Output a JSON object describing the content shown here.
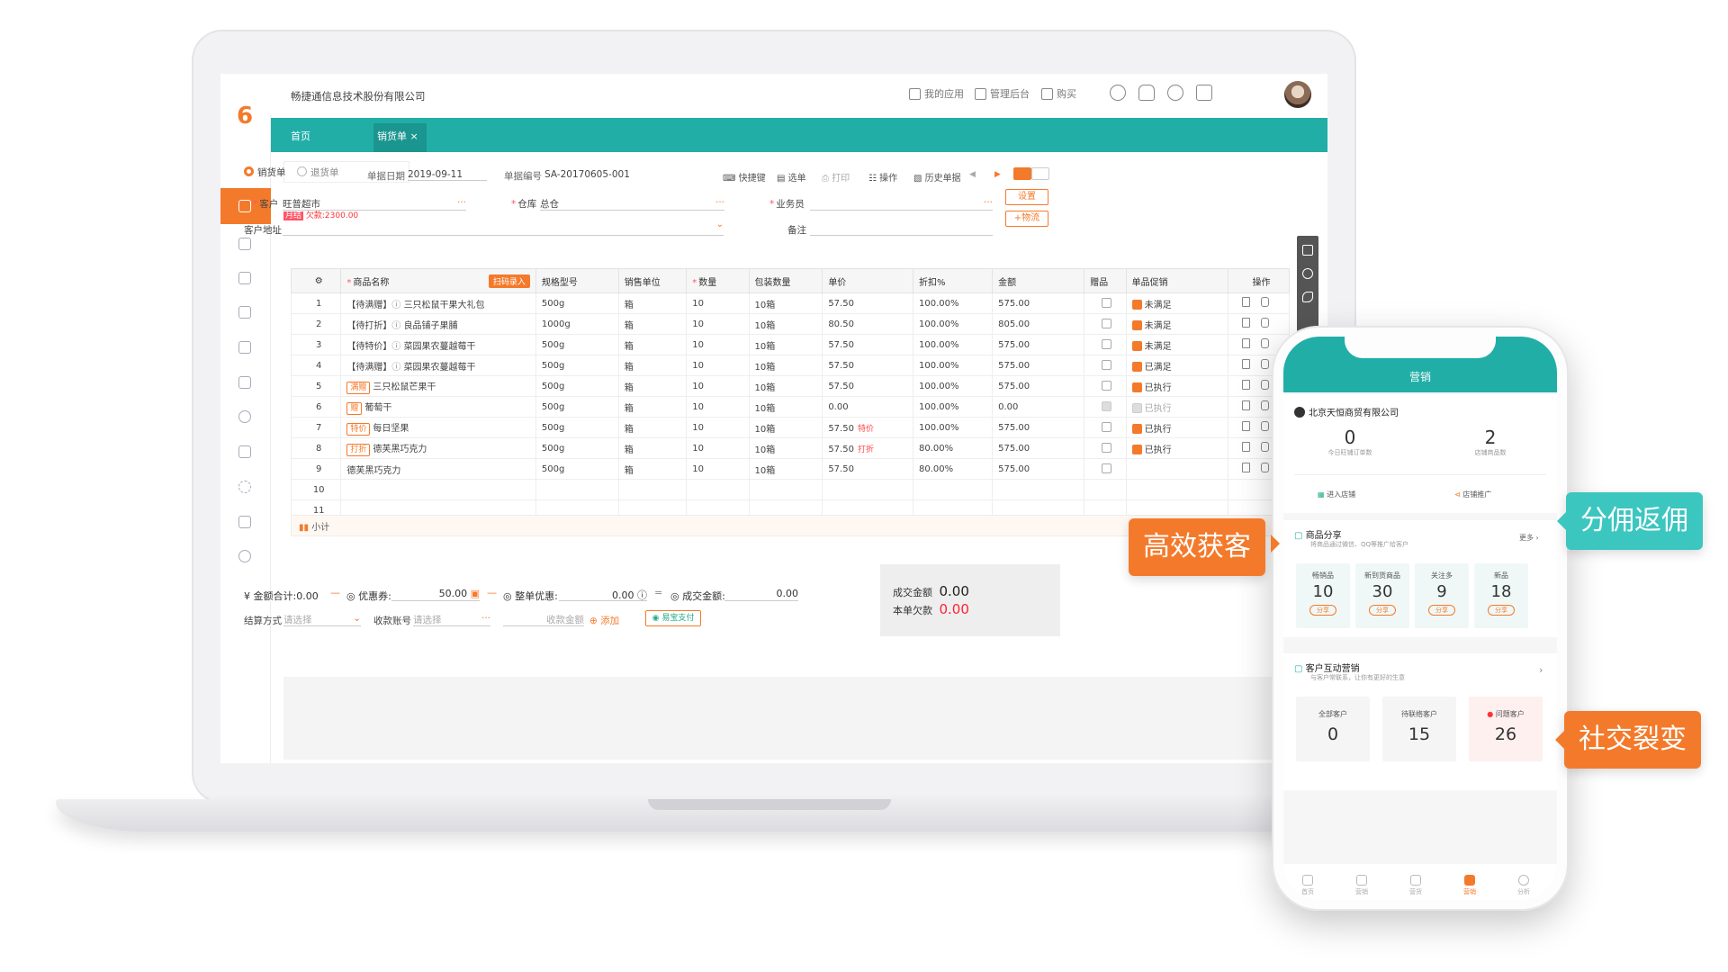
{
  "app": {
    "company": "畅捷通信息技术股份有限公司",
    "top_nav": [
      "我的应用",
      "管理后台",
      "购买"
    ],
    "tabs": [
      "首页",
      "销货单"
    ]
  },
  "form": {
    "types": [
      "销货单",
      "退货单"
    ],
    "date_label": "单据日期",
    "date_value": "2019-09-11",
    "no_label": "单据编号",
    "no_value": "SA-20170605-001",
    "tools": [
      "快捷键",
      "选单",
      "打印",
      "操作",
      "历史单据"
    ],
    "customer_label": "客户",
    "customer_value": "旺普超市",
    "monthly_tag": "月结",
    "debt_text": "欠款:2300.00",
    "warehouse_label": "仓库",
    "warehouse_value": "总仓",
    "salesman_label": "业务员",
    "address_label": "客户地址",
    "remark_label": "备注",
    "settings_btn": "设置",
    "logistics_btn": "+物流"
  },
  "table": {
    "headers": [
      "商品名称",
      "扫码录入",
      "规格型号",
      "销售单位",
      "数量",
      "包装数量",
      "单价",
      "折扣%",
      "金额",
      "赠品",
      "单品促销",
      "操作"
    ],
    "rows": [
      {
        "n": "1",
        "tag": "",
        "name": "【待满赠】",
        "name2": "三只松鼠干果大礼包",
        "spec": "500g",
        "unit": "箱",
        "qty": "10",
        "pack": "10箱",
        "price": "57.50",
        "price_tag": "",
        "disc": "100.00%",
        "amt": "575.00",
        "promo": "未满足",
        "gift": "0",
        "promo_on": "1"
      },
      {
        "n": "2",
        "tag": "",
        "name": "【待打折】",
        "name2": "良品铺子果脯",
        "spec": "1000g",
        "unit": "箱",
        "qty": "10",
        "pack": "10箱",
        "price": "80.50",
        "price_tag": "",
        "disc": "100.00%",
        "amt": "805.00",
        "promo": "未满足",
        "gift": "0",
        "promo_on": "1"
      },
      {
        "n": "3",
        "tag": "",
        "name": "【待特价】",
        "name2": "菜园果农蔓越莓干",
        "spec": "500g",
        "unit": "箱",
        "qty": "10",
        "pack": "10箱",
        "price": "57.50",
        "price_tag": "",
        "disc": "100.00%",
        "amt": "575.00",
        "promo": "未满足",
        "gift": "0",
        "promo_on": "1"
      },
      {
        "n": "4",
        "tag": "",
        "name": "【待满赠】",
        "name2": "菜园果农蔓越莓干",
        "spec": "500g",
        "unit": "箱",
        "qty": "10",
        "pack": "10箱",
        "price": "57.50",
        "price_tag": "",
        "disc": "100.00%",
        "amt": "575.00",
        "promo": "已满足",
        "gift": "0",
        "promo_on": "1"
      },
      {
        "n": "5",
        "tag": "满赠",
        "name": "",
        "name2": "三只松鼠芒果干",
        "spec": "500g",
        "unit": "箱",
        "qty": "10",
        "pack": "10箱",
        "price": "57.50",
        "price_tag": "",
        "disc": "100.00%",
        "amt": "575.00",
        "promo": "已执行",
        "gift": "0",
        "promo_on": "1"
      },
      {
        "n": "6",
        "tag": "赠",
        "name": "",
        "name2": "葡萄干",
        "spec": "500g",
        "unit": "箱",
        "qty": "10",
        "pack": "10箱",
        "price": "0.00",
        "price_tag": "",
        "disc": "100.00%",
        "amt": "0.00",
        "promo": "已执行",
        "gift": "1",
        "promo_on": "0"
      },
      {
        "n": "7",
        "tag": "特价",
        "name": "",
        "name2": "每日坚果",
        "spec": "500g",
        "unit": "箱",
        "qty": "10",
        "pack": "10箱",
        "price": "57.50",
        "price_tag": "特价",
        "disc": "100.00%",
        "amt": "575.00",
        "promo": "已执行",
        "gift": "0",
        "promo_on": "1"
      },
      {
        "n": "8",
        "tag": "打折",
        "name": "",
        "name2": "德芙黑巧克力",
        "spec": "500g",
        "unit": "箱",
        "qty": "10",
        "pack": "10箱",
        "price": "57.50",
        "price_tag": "打折",
        "disc": "80.00%",
        "amt": "575.00",
        "promo": "已执行",
        "gift": "0",
        "promo_on": "1"
      },
      {
        "n": "9",
        "tag": "",
        "name": "",
        "name2": "德芙黑巧克力",
        "spec": "500g",
        "unit": "箱",
        "qty": "10",
        "pack": "10箱",
        "price": "57.50",
        "price_tag": "",
        "disc": "80.00%",
        "amt": "575.00",
        "promo": "",
        "gift": "0",
        "promo_on": "0"
      },
      {
        "n": "10",
        "tag": "",
        "name": "",
        "name2": "",
        "spec": "",
        "unit": "",
        "qty": "",
        "pack": "",
        "price": "",
        "price_tag": "",
        "disc": "",
        "amt": "",
        "promo": "",
        "gift": "",
        "promo_on": "0"
      },
      {
        "n": "11",
        "tag": "",
        "name": "",
        "name2": "",
        "spec": "",
        "unit": "",
        "qty": "",
        "pack": "",
        "price": "",
        "price_tag": "",
        "disc": "",
        "amt": "",
        "promo": "",
        "gift": "",
        "promo_on": "0"
      }
    ],
    "subtotal": "小计"
  },
  "footer": {
    "amount_total_label": "金额合计:",
    "amount_total": "0.00",
    "coupon_label": "优惠券:",
    "coupon": "50.00",
    "order_discount_label": "整单优惠:",
    "order_discount": "0.00",
    "deal_amount_label": "成交金额:",
    "deal_amount": "0.00",
    "settle_label": "结算方式",
    "settle_placeholder": "请选择",
    "account_label": "收款账号",
    "account_placeholder": "请选择",
    "receive_label": "收款金额",
    "add_label": "添加",
    "pay_label": "易宝支付",
    "summary_deal_label": "成交金额",
    "summary_deal": "0.00",
    "summary_debt_label": "本单欠款",
    "summary_debt": "0.00"
  },
  "phone": {
    "title": "营销",
    "company": "北京天恒商贸有限公司",
    "stats": [
      {
        "v": "0",
        "l": "今日旺铺订单数"
      },
      {
        "v": "2",
        "l": "店铺商品数"
      }
    ],
    "links": [
      "进入店铺",
      "店铺推广"
    ],
    "share_title": "商品分享",
    "share_sub": "将商品通过微信、QQ等推广给客户",
    "more": "更多",
    "share_items": [
      {
        "t": "畅销品",
        "v": "10"
      },
      {
        "t": "新到货商品",
        "v": "30"
      },
      {
        "t": "关注多",
        "v": "9"
      },
      {
        "t": "新品",
        "v": "18"
      }
    ],
    "share_btn": "分享",
    "interact_title": "客户互动营销",
    "interact_sub": "与客户常联系，让你有更好的生意",
    "customers": [
      {
        "t": "全部客户",
        "v": "0"
      },
      {
        "t": "待联络客户",
        "v": "15"
      },
      {
        "t": "问题客户",
        "v": "26"
      }
    ],
    "nav": [
      "首页",
      "营销",
      "营货",
      "营销",
      "分析"
    ]
  },
  "callouts": [
    "高效获客",
    "分佣返佣",
    "社交裂变"
  ],
  "colors": {
    "orange": "#f47a2b",
    "teal": "#21aea7",
    "red": "#f22233"
  }
}
